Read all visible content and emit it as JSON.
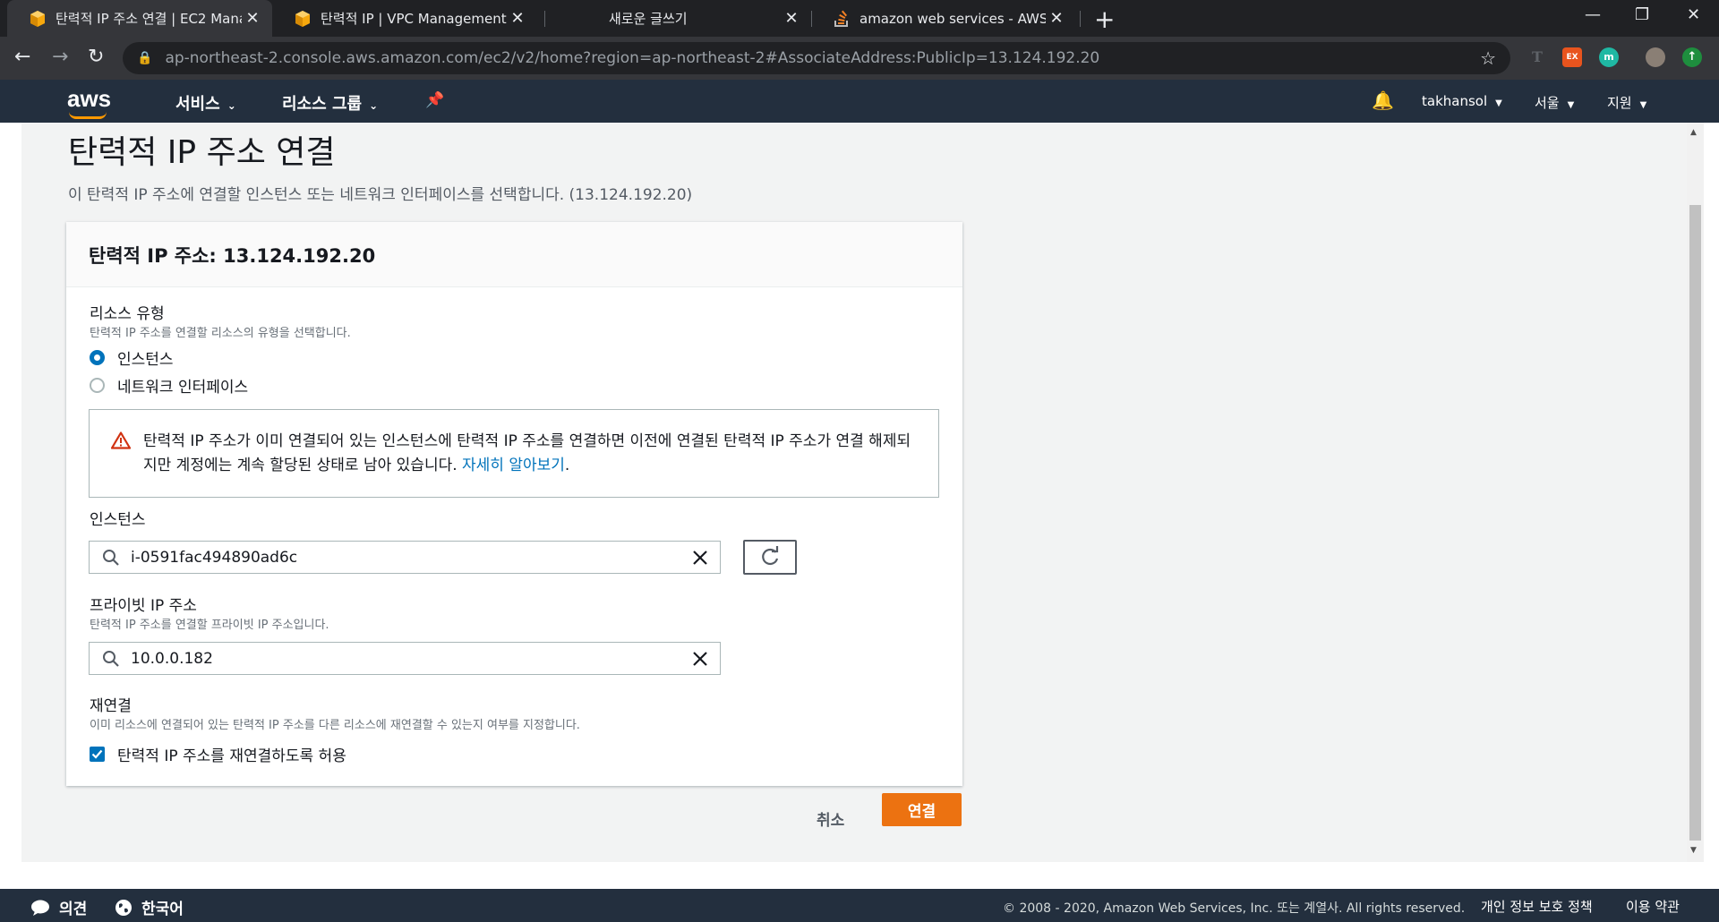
{
  "browser": {
    "tabs": [
      {
        "title": "탄력적 IP 주소 연결 | EC2 Mana",
        "icon": "aws-cube-icon"
      },
      {
        "title": "탄력적 IP | VPC Management C",
        "icon": "aws-cube-icon"
      },
      {
        "title": "새로운 글쓰기",
        "icon": "none"
      },
      {
        "title": "amazon web services - AWS Ca",
        "icon": "stackoverflow-icon"
      }
    ],
    "url": "ap-northeast-2.console.aws.amazon.com/ec2/v2/home?region=ap-northeast-2#AssociateAddress:PublicIp=13.124.192.20",
    "extensions": [
      "T",
      "EX",
      "m"
    ]
  },
  "aws_nav": {
    "logo": "aws",
    "services": "서비스",
    "resource_groups": "리소스 그룹",
    "user": "takhansol",
    "region": "서울",
    "support": "지원"
  },
  "page": {
    "title": "탄력적 IP 주소 연결",
    "description": "이 탄력적 IP 주소에 연결할 인스턴스 또는 네트워크 인터페이스를 선택합니다. (13.124.192.20)"
  },
  "panel": {
    "header": "탄력적 IP 주소: 13.124.192.20",
    "resource_type": {
      "label": "리소스 유형",
      "help": "탄력적 IP 주소를 연결할 리소스의 유형을 선택합니다.",
      "options": [
        {
          "label": "인스턴스",
          "selected": true
        },
        {
          "label": "네트워크 인터페이스",
          "selected": false
        }
      ]
    },
    "alert": {
      "text": "탄력적 IP 주소가 이미 연결되어 있는 인스턴스에 탄력적 IP 주소를 연결하면 이전에 연결된 탄력적 IP 주소가 연결 해제되지만 계정에는 계속 할당된 상태로 남아 있습니다. ",
      "link": "자세히 알아보기",
      "suffix": "."
    },
    "instance": {
      "label": "인스턴스",
      "value": "i-0591fac494890ad6c"
    },
    "private_ip": {
      "label": "프라이빗 IP 주소",
      "help": "탄력적 IP 주소를 연결할 프라이빗 IP 주소입니다.",
      "value": "10.0.0.182"
    },
    "reassociation": {
      "label": "재연결",
      "help": "이미 리소스에 연결되어 있는 탄력적 IP 주소를 다른 리소스에 재연결할 수 있는지 여부를 지정합니다.",
      "checkbox": "탄력적 IP 주소를 재연결하도록 허용",
      "checked": true
    }
  },
  "actions": {
    "cancel": "취소",
    "associate": "연결"
  },
  "footer": {
    "feedback": "의견",
    "language": "한국어",
    "copyright": "© 2008 - 2020, Amazon Web Services, Inc. 또는 계열사. All rights reserved.",
    "privacy": "개인 정보 보호 정책",
    "terms": "이용 약관"
  },
  "colors": {
    "aws_nav": "#232f3e",
    "primary": "#ec7211",
    "link": "#0073bb",
    "alert": "#d13212"
  }
}
